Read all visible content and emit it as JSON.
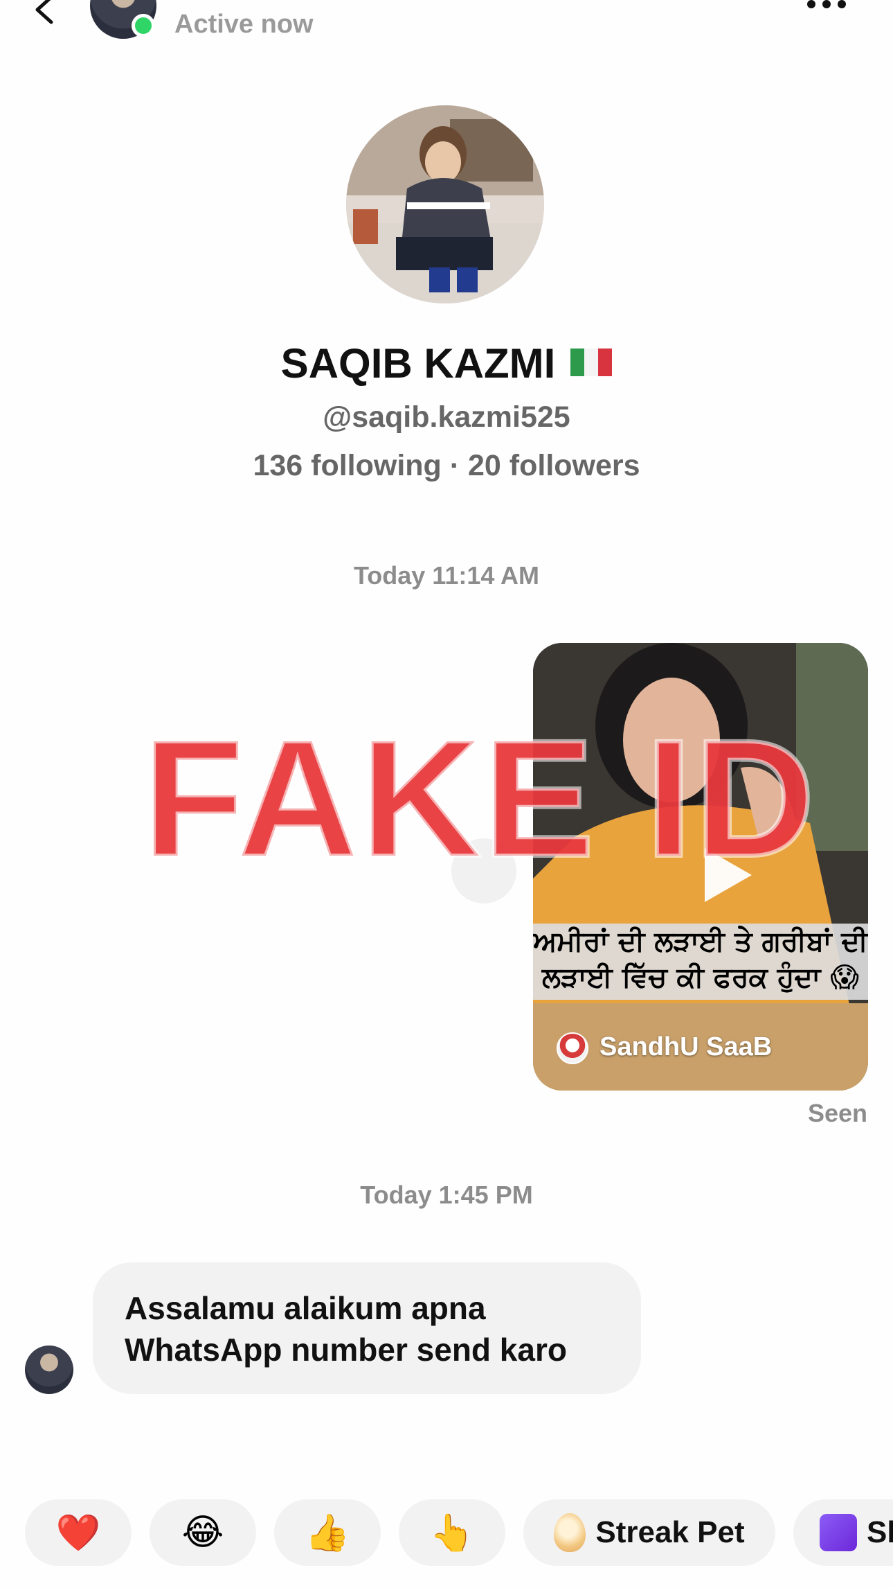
{
  "header": {
    "status": "Active now"
  },
  "profile": {
    "name": "SAQIB KAZMI",
    "flag_icon": "italy-flag-icon",
    "handle": "@saqib.kazmi525",
    "stats": "136 following · 20 followers"
  },
  "conversation": {
    "timestamp_1": "Today 11:14 AM",
    "shared_video": {
      "caption": "ਅਮੀਰਾਂ ਦੀ ਲੜਾਈ ਤੇ ਗਰੀਬਾਂ ਦੀ ਲੜਾਈ ਵਿੱਚ ਕੀ ਫਰਕ ਹੁੰਦਾ 😱",
      "author": "SandhU SaaB",
      "play_icon": "play-icon"
    },
    "overlay_text": "FAKE ID",
    "seen_label": "Seen",
    "timestamp_2": "Today 1:45 PM",
    "incoming_message": "Assalamu alaikum apna WhatsApp number send karo"
  },
  "quick_reactions": [
    {
      "emoji": "❤️",
      "label": ""
    },
    {
      "emoji": "😂",
      "label": ""
    },
    {
      "emoji": "👍",
      "label": ""
    },
    {
      "emoji": "👆",
      "label": ""
    },
    {
      "emoji": "",
      "label": "Streak Pet"
    },
    {
      "emoji": "",
      "label": "Sh"
    }
  ],
  "colors": {
    "online": "#2fd567",
    "overlay": "#e8393d",
    "bubble": "#f2f2f2",
    "muted_text": "#8c8c8c"
  }
}
